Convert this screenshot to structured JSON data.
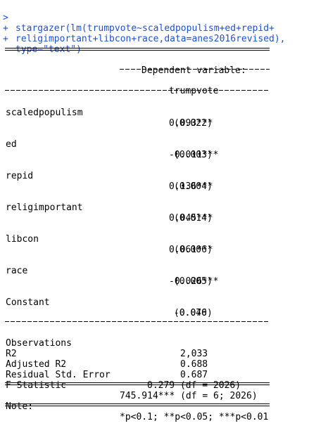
{
  "console": {
    "command_lines": [
      {
        "prompt": ">",
        "text": "stargazer(lm(trumpvote~scaledpopulism+ed+repid+"
      },
      {
        "prompt": "+",
        "text": "religimportant+libcon+race,data=anes2016revised),"
      },
      {
        "prompt": "+",
        "text": "type=\"text\")"
      }
    ],
    "colors": {
      "command": "#1f4fd6",
      "output": "#000000"
    }
  },
  "table": {
    "header": {
      "dependent_label": "Dependent variable:",
      "dependent_name": "trumpvote"
    },
    "rows": [
      {
        "name": "scaledpopulism",
        "coef": "0.093***",
        "se": "(0.022)"
      },
      {
        "name": "ed",
        "coef": "-0.011***",
        "se": "(0.003)"
      },
      {
        "name": "repid",
        "coef": "0.136***",
        "se": "(0.004)"
      },
      {
        "name": "religimportant",
        "coef": "0.045***",
        "se": "(0.014)"
      },
      {
        "name": "libcon",
        "coef": "0.061***",
        "se": "(0.006)"
      },
      {
        "name": "race",
        "coef": "-0.026***",
        "se": "(0.005)"
      },
      {
        "name": "Constant",
        "coef": "-0.070",
        "se": "(0.046)"
      }
    ],
    "stats": [
      {
        "label": "Observations",
        "value": "2,033"
      },
      {
        "label": "R2",
        "value": "0.688"
      },
      {
        "label": "Adjusted R2",
        "value": "0.687"
      },
      {
        "label": "Residual Std. Error",
        "value": "0.279 (df = 2026)"
      },
      {
        "label": "F Statistic",
        "value": "745.914*** (df = 6; 2026)"
      }
    ],
    "note": {
      "label": "Note:",
      "text": "*p<0.1; **p<0.05; ***p<0.01"
    }
  }
}
